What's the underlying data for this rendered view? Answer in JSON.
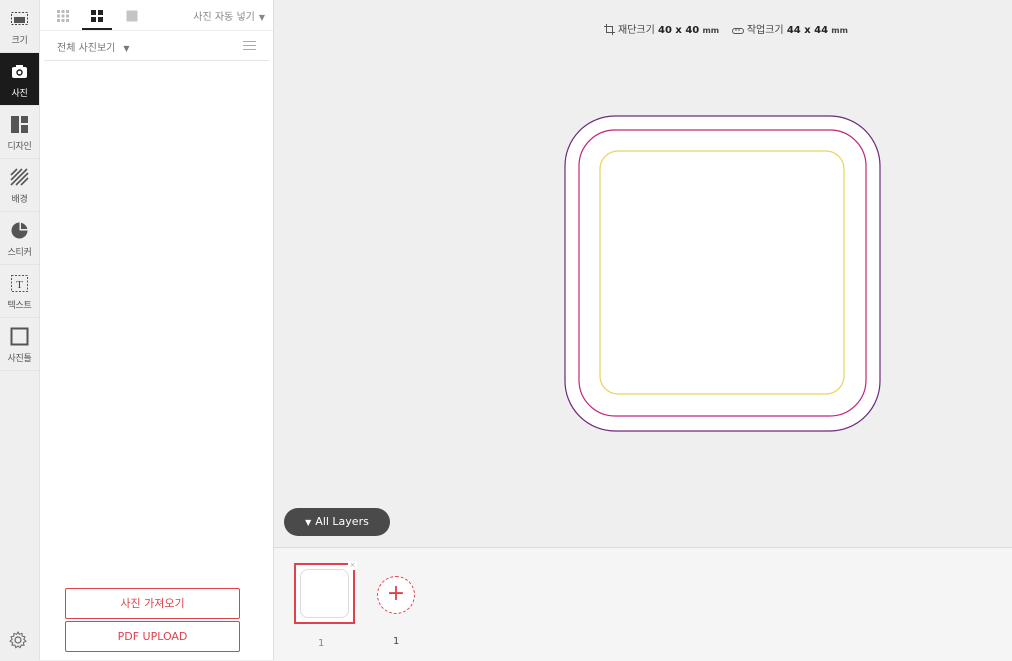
{
  "sidebar": {
    "items": [
      {
        "label": "크기",
        "icon": "size-icon"
      },
      {
        "label": "사진",
        "icon": "camera-icon",
        "active": true
      },
      {
        "label": "디자인",
        "icon": "layout-icon"
      },
      {
        "label": "배경",
        "icon": "stripes-icon"
      },
      {
        "label": "스티커",
        "icon": "sticker-icon"
      },
      {
        "label": "텍스트",
        "icon": "text-icon"
      },
      {
        "label": "사진틀",
        "icon": "frame-icon"
      }
    ],
    "settings_icon": "gear-icon"
  },
  "photo_panel": {
    "view_modes": [
      "small-grid",
      "large-grid",
      "single"
    ],
    "selected_view": "large-grid",
    "auto_insert_label": "사진 자동 넣기",
    "filter_label": "전체 사진보기",
    "import_button": "사진 가져오기",
    "pdf_button": "PDF UPLOAD"
  },
  "canvas": {
    "cut_size_label": "재단크기",
    "cut_size_value": "40 x 40",
    "cut_size_unit": "mm",
    "work_size_label": "작업크기",
    "work_size_value": "44 x 44",
    "work_size_unit": "mm",
    "layers_button": "All Layers",
    "guide_colors": {
      "outer": "#6b2a7b",
      "cut": "#c2257a",
      "safe": "#e8d35a"
    }
  },
  "pages": {
    "thumb_number": "1",
    "add_count": "1"
  },
  "colors": {
    "accent": "#e0424c",
    "dark": "#1b1b1b"
  }
}
